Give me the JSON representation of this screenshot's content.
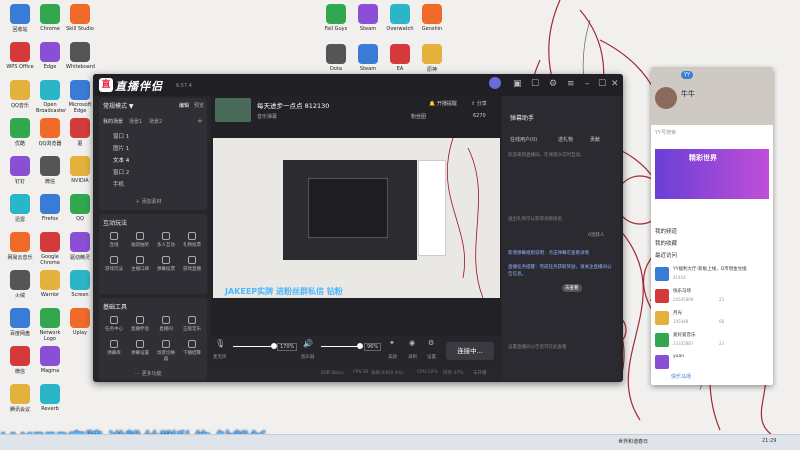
{
  "app": {
    "name": "直播伴侣",
    "version": "6.57.4",
    "tabs": {
      "mode": "常规模式 ▼",
      "edit": "编辑",
      "preview": "预览"
    },
    "scene": {
      "label": "我的场景",
      "scene1": "场景1",
      "scene2": "场景2"
    },
    "sources": [
      "窗口 1",
      "图片 1",
      "文本 4",
      "窗口 2",
      "手机"
    ],
    "add_source": "添加素材",
    "interactive_title": "互动玩法",
    "interactive_items": [
      "连线",
      "福袋抽奖",
      "多人互动",
      "礼物投票",
      "游戏玩法",
      "主播口碑",
      "弹幕投票",
      "游戏直播"
    ],
    "tools_title": "基础工具",
    "tools_items": [
      "任务中心",
      "直播伴侣",
      "直播间",
      "正版音乐",
      "弹幕库",
      "弹幕设置",
      "场景切换器",
      "下播结算"
    ],
    "more": "更多功能",
    "room_title": "每天进步一点点 812130",
    "room_sub": "音乐弹幕",
    "room_badge": "粉丝团",
    "fans": "6270",
    "live_btn": "开播提醒",
    "share": "分享",
    "mic_label": "麦克风",
    "mic_value": "170%",
    "speaker_label": "扬声器",
    "speaker_value": "96%",
    "btn_beauty": "美颜",
    "btn_record": "录制",
    "btn_settings": "设置",
    "start_live": "连接中...",
    "status": [
      "码率:0kb/s",
      "FPS:30",
      "丢帧:0/0(0.0%)",
      "CPU:12%",
      "内存:47%",
      "未开播"
    ],
    "overlay": "JAKEEP实牌  进粉丝群私信 钻粉"
  },
  "assistant": {
    "title": "弹幕助手",
    "tabs": [
      "在线用户(0)",
      "送礼物",
      "贡献"
    ],
    "online_text": "欢迎来到直播间，在线观众实时互动。",
    "rank_info": "送出礼物可以获得贡献排名",
    "msg1": "新增弹幕规则说明：点击弹幕可查看详情",
    "msg2": "直播任务提醒：完成任务获取奖励，请关注直播间公告信息。",
    "go_btn": "去查看",
    "tag": "0活跃人",
    "bottom": "设置直播间公告后可在此查看"
  },
  "yy": {
    "user": "牛牛",
    "search": "YY号搜索",
    "banner_title": "精彩世界",
    "items": [
      "我的频道",
      "我的收藏",
      "最近访问"
    ],
    "channels": [
      {
        "name": "YY福利大厅-新板上线，Q币現金兌換",
        "id": "41454"
      },
      {
        "name": "快乐马场",
        "id": "24545869",
        "count": "23"
      },
      {
        "name": "月光",
        "id": "145448",
        "count": "68"
      },
      {
        "name": "爱好爱音乐",
        "id": "23335887",
        "count": "23"
      },
      {
        "name": "yuan",
        "id": ""
      }
    ],
    "bottom_btn": "快乐马场"
  },
  "taskbar": {
    "weather": "世界和谐春日",
    "time": "21:29"
  },
  "bottom_banner": "JAKEEP实牌  进粉丝群私信 钻粉衫",
  "desktop_icons": [
    "回收站",
    "WPS Office",
    "QQ音乐",
    "优酷",
    "钉钉",
    "迅雷",
    "网易云音乐",
    "火绒",
    "百度网盘",
    "微信",
    "腾讯会议",
    "Chrome",
    "Edge",
    "Open Broadcaster",
    "QQ浏览器",
    "微信",
    "Firefox",
    "Google Chrome",
    "Warrior",
    "Network Logo",
    "Magma",
    "Reverb",
    "Skill Studio",
    "Whiteboard",
    "Microsoft Edge",
    "驱",
    "NVIDIA",
    "QQ",
    "驱动精灵",
    "Screen",
    "Uplay"
  ],
  "top_icons": [
    "Fall Guys",
    "Steam",
    "Overwatch",
    "Genshin",
    "Dota",
    "Steam",
    "EA",
    "原神"
  ],
  "colors": {
    "accent": "#4db7ff",
    "app_bg": "#26262b",
    "panel": "#2f2f35"
  }
}
